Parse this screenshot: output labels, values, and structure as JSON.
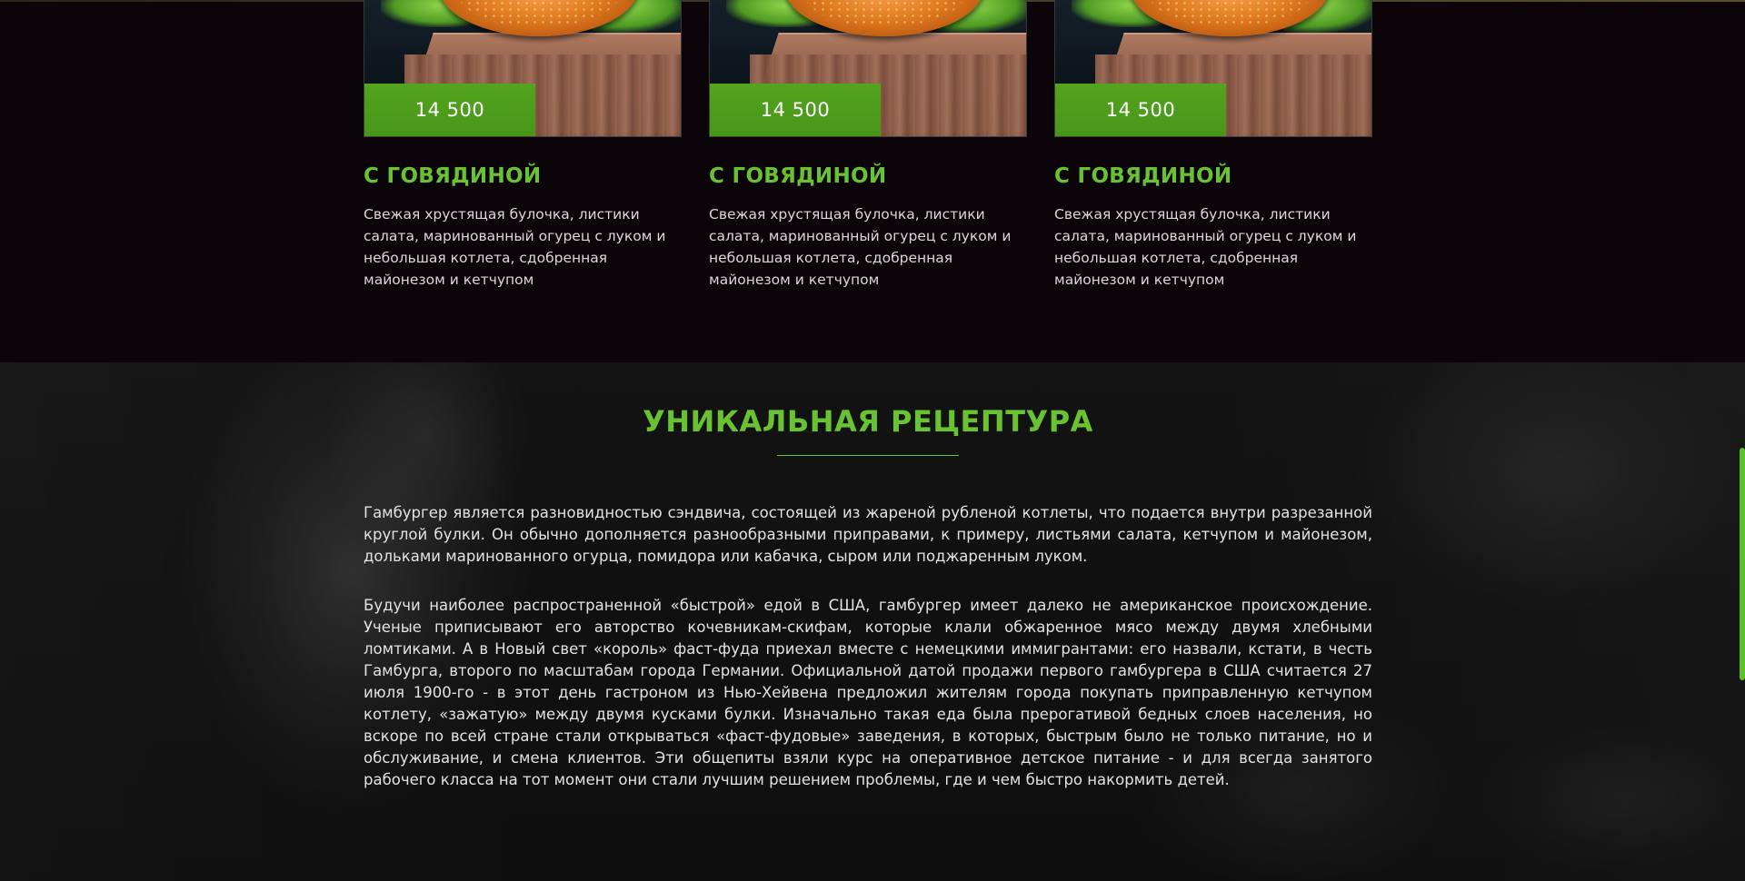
{
  "products": {
    "cards": [
      {
        "price": "14 500",
        "title": "С ГОВЯДИНОЙ",
        "description": "Свежая хрустящая булочка, листики салата, маринованный огурец с луком и небольшая котлета, сдобренная майонезом и кетчупом"
      },
      {
        "price": "14 500",
        "title": "С ГОВЯДИНОЙ",
        "description": "Свежая хрустящая булочка, листики салата, маринованный огурец с луком и небольшая котлета, сдобренная майонезом и кетчупом"
      },
      {
        "price": "14 500",
        "title": "С ГОВЯДИНОЙ",
        "description": "Свежая хрустящая булочка, листики салата, маринованный огурец с луком и небольшая котлета, сдобренная майонезом и кетчупом"
      }
    ]
  },
  "recipe": {
    "title": "УНИКАЛЬНАЯ РЕЦЕПТУРА",
    "paragraphs": [
      "Гамбургер является разновидностью сэндвича, состоящей из жареной рубленой котлеты, что подается внутри разрезанной круглой булки. Он обычно дополняется разнообразными приправами, к примеру, листьями салата, кетчупом и майонезом, дольками маринованного огурца, помидора или кабачка, сыром или поджаренным луком.",
      "Будучи наиболее распространенной «быстрой» едой в США, гамбургер имеет далеко не американское происхождение. Ученые приписывают его авторство кочевникам-скифам, которые клали обжаренное мясо между двумя хлебными ломтиками. А в Новый свет «король» фаст-фуда приехал вместе с немецкими иммигрантами: его назвали, кстати, в честь Гамбурга, второго по масштабам города Германии. Официальной датой продажи первого гамбургера в США считается 27 июля 1900-го - в этот день гастроном из Нью-Хейвена предложил жителям города покупать приправленную кетчупом котлету, «зажатую» между двумя кусками булки. Изначально такая еда была прерогативой бедных слоев населения, но вскоре по всей стране стали открываться «фаст-фудовые» заведения, в которых, быстрым было не только питание, но и обслуживание, и смена клиентов. Эти общепиты взяли курс на оперативное детское питание - и для всегда занятого рабочего класса на тот момент они стали лучшим решением проблемы, где и чем быстро накормить детей."
    ]
  },
  "colors": {
    "accent": "#69c231",
    "price_badge": "#4a9a1a",
    "background_dark": "#0b0408",
    "text_light": "#d9d9d9"
  }
}
